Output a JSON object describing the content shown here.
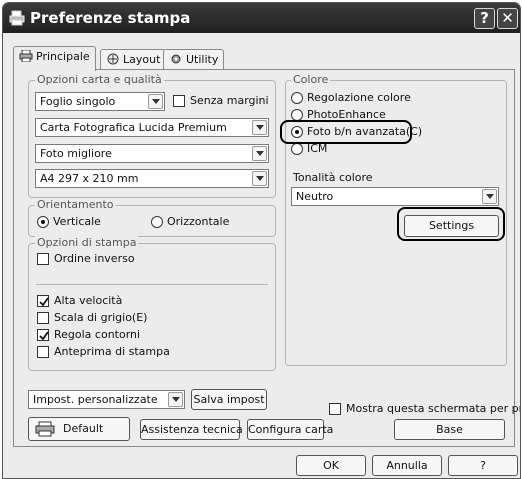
{
  "window": {
    "title": "Preferenze stampa",
    "help_button": "?",
    "close_button": "✕"
  },
  "tabs": [
    {
      "label": "Principale"
    },
    {
      "label": "Layout"
    },
    {
      "label": "Utility"
    }
  ],
  "paper_quality": {
    "legend": "Opzioni carta e qualità",
    "paper_source": "Foglio singolo",
    "borderless_label": "Senza margini",
    "paper_type": "Carta Fotografica Lucida Premium",
    "quality": "Foto migliore",
    "paper_size": "A4 297 x 210 mm"
  },
  "orientation": {
    "legend": "Orientamento",
    "portrait": "Verticale",
    "landscape": "Orizzontale"
  },
  "print_options": {
    "legend": "Opzioni di stampa",
    "reverse_order": "Ordine inverso",
    "high_speed": "Alta velocità",
    "grayscale": "Scala di grigio(E)",
    "edge_smoothing": "Regola contorni",
    "print_preview": "Anteprima di stampa"
  },
  "custom": {
    "select_value": "Impost. personalizzate",
    "save_label": "Salva impost"
  },
  "color": {
    "legend": "Colore",
    "options": [
      "Regolazione colore",
      "PhotoEnhance",
      "Foto b/n avanzata(C)",
      "ICM"
    ],
    "tone_label": "Tonalità colore",
    "tone_value": "Neutro",
    "settings_label": "Settings"
  },
  "footer": {
    "show_screen_label": "Mostra questa schermata per prima",
    "default_label": "Default",
    "tech_support_label": "Assistenza tecnica",
    "configure_paper_label": "Configura carta",
    "base_label": "Base"
  },
  "dialog": {
    "ok_label": "OK",
    "cancel_label": "Annulla",
    "help_label": "?"
  }
}
